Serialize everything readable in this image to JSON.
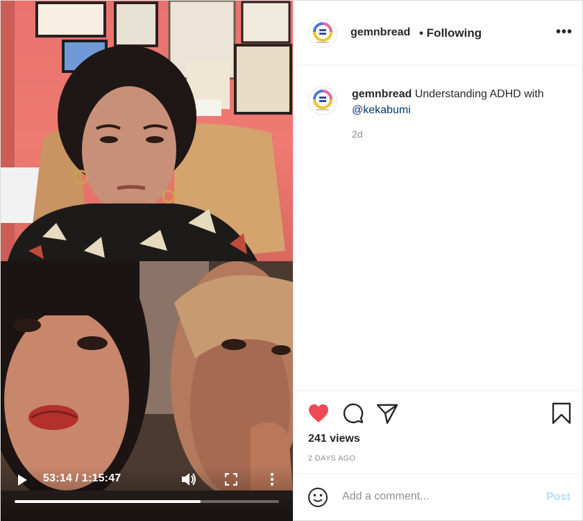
{
  "post": {
    "username": "gemnbread",
    "following_label": "• Following",
    "more_label": "•••",
    "caption_user": "gemnbread",
    "caption_text": "Understanding ADHD with",
    "caption_mention": "@kekabumi",
    "age_short": "2d",
    "views": "241 views",
    "age_long": "2 DAYS AGO",
    "liked": true,
    "colors": {
      "like": "#ed4956",
      "link": "#00376b",
      "post_button": "#b2dffc",
      "muted": "#8e8e8e"
    }
  },
  "video": {
    "time_display": "53:14 / 1:15:47",
    "progress": 0.703,
    "icons": [
      "play-icon",
      "volume-icon",
      "fullscreen-icon",
      "more-vertical-icon"
    ]
  },
  "comment": {
    "placeholder": "Add a comment...",
    "post_label": "Post"
  }
}
